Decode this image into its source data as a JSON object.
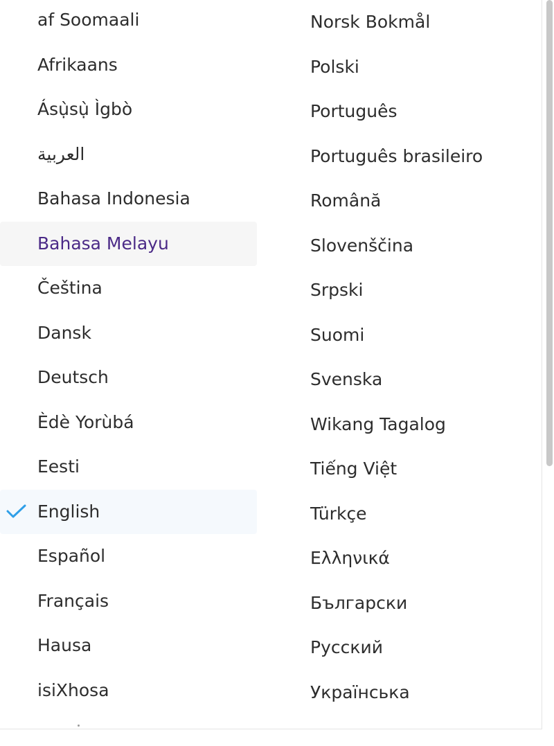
{
  "language_menu": {
    "left_column": [
      {
        "label": "af Soomaali"
      },
      {
        "label": "Afrikaans"
      },
      {
        "label": "Ásụ̀sụ̀ Ìgbò"
      },
      {
        "label": "العربية"
      },
      {
        "label": "Bahasa Indonesia"
      },
      {
        "label": "Bahasa Melayu",
        "state": "hovered"
      },
      {
        "label": "Čeština"
      },
      {
        "label": "Dansk"
      },
      {
        "label": "Deutsch"
      },
      {
        "label": "Èdè Yorùbá"
      },
      {
        "label": "Eesti"
      },
      {
        "label": "English",
        "state": "selected"
      },
      {
        "label": "Español"
      },
      {
        "label": "Français"
      },
      {
        "label": "Hausa"
      },
      {
        "label": "isiXhosa"
      }
    ],
    "right_column": [
      {
        "label": "Norsk Bokmål"
      },
      {
        "label": "Polski"
      },
      {
        "label": "Português"
      },
      {
        "label": "Português brasileiro"
      },
      {
        "label": "Română"
      },
      {
        "label": "Slovenščina"
      },
      {
        "label": "Srpski"
      },
      {
        "label": "Suomi"
      },
      {
        "label": "Svenska"
      },
      {
        "label": "Wikang Tagalog"
      },
      {
        "label": "Tiếng Việt"
      },
      {
        "label": "Türkçe"
      },
      {
        "label": "Ελληνικά"
      },
      {
        "label": "Български"
      },
      {
        "label": "Русский"
      },
      {
        "label": "Українська"
      }
    ],
    "selected_icon": "check-icon",
    "colors": {
      "text": "#2d2d2d",
      "hover_text": "#4b2a87",
      "hover_background": "#f6f6f6",
      "selected_background": "#f5f9fd",
      "check": "#2f9fe8",
      "scrollbar_thumb": "#c8c8c8"
    },
    "scroll": {
      "visible_fraction": 0.64,
      "position_fraction": 0
    }
  }
}
